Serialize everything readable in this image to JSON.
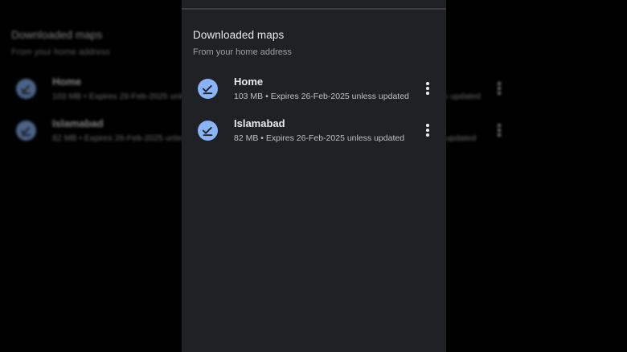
{
  "section": {
    "title": "Downloaded maps",
    "subtitle": "From your home address"
  },
  "maps": [
    {
      "name": "Home",
      "meta": "103 MB • Expires 26-Feb-2025 unless updated",
      "icon": "download-done-icon"
    },
    {
      "name": "Islamabad",
      "meta": "82 MB • Expires 26-Feb-2025 unless updated",
      "icon": "download-done-icon"
    }
  ],
  "colors": {
    "panel_bg": "#202124",
    "accent": "#8ab4f8",
    "text_primary": "#e8eaed",
    "text_secondary": "#9aa0a6"
  }
}
